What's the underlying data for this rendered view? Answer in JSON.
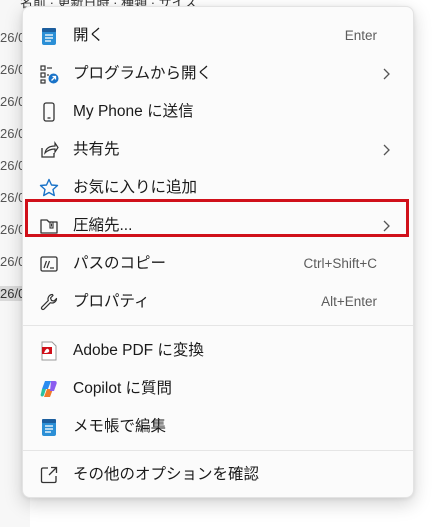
{
  "background": {
    "top_text": "名前  ·  更新日時  ·  種類  ·  サイズ",
    "rows": [
      "26/0",
      "26/0",
      "26/0",
      "26/0",
      "26/0",
      "26/0",
      "26/0",
      "26/0",
      "26/0",
      "26/0"
    ]
  },
  "menu": {
    "items": [
      {
        "label": "開く",
        "shortcut": "Enter",
        "icon": "notepad-icon"
      },
      {
        "label": "プログラムから開く",
        "shortcut": "",
        "icon": "open-with-icon"
      },
      {
        "label": "My Phone に送信",
        "shortcut": "",
        "icon": "phone-icon"
      },
      {
        "label": "共有先",
        "shortcut": "",
        "icon": "share-icon"
      },
      {
        "label": "お気に入りに追加",
        "shortcut": "",
        "icon": "star-icon"
      },
      {
        "label": "圧縮先...",
        "shortcut": "",
        "icon": "zip-folder-icon"
      },
      {
        "label": "パスのコピー",
        "shortcut": "Ctrl+Shift+C",
        "icon": "copy-path-icon"
      },
      {
        "label": "プロパティ",
        "shortcut": "Alt+Enter",
        "icon": "wrench-icon"
      },
      {
        "label": "Adobe PDF に変換",
        "shortcut": "",
        "icon": "adobe-pdf-icon"
      },
      {
        "label": "Copilot に質問",
        "shortcut": "",
        "icon": "copilot-icon"
      },
      {
        "label": "メモ帳で編集",
        "shortcut": "",
        "icon": "notepad-icon"
      },
      {
        "label": "その他のオプションを確認",
        "shortcut": "",
        "icon": "more-options-icon"
      }
    ]
  },
  "colors": {
    "highlight_border": "#d0101a",
    "accent_blue": "#1a73c8"
  }
}
